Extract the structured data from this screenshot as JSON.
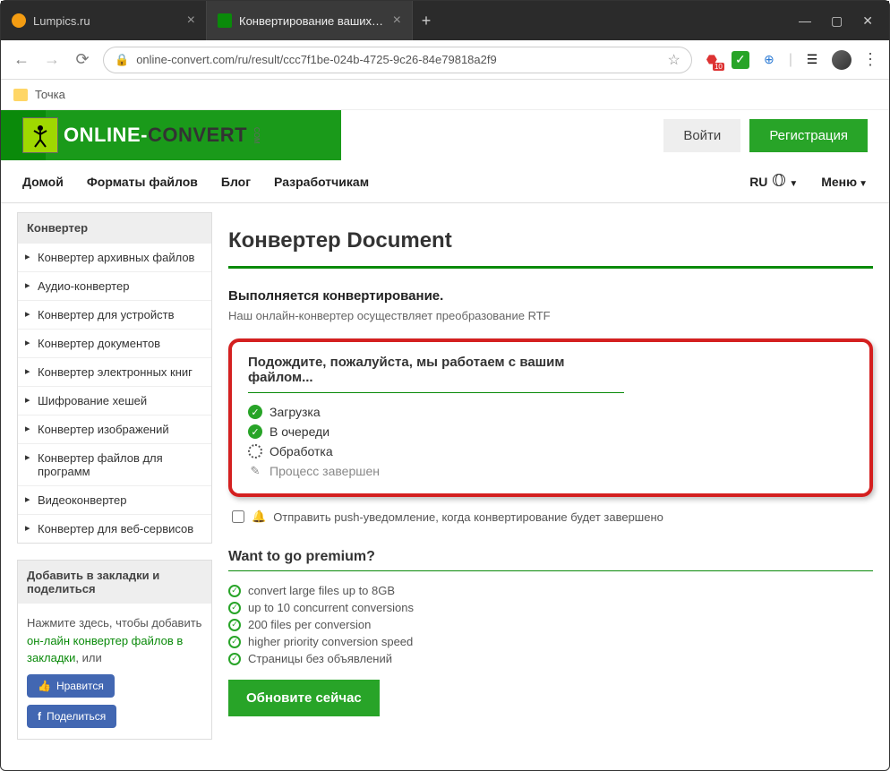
{
  "browser": {
    "tabs": [
      {
        "title": "Lumpics.ru"
      },
      {
        "title": "Конвертирование ваших файло"
      }
    ],
    "url": "online-convert.com/ru/result/ccc7f1be-024b-4725-9c26-84e79818a2f9",
    "bookmark": "Точка",
    "ext_badge": "10"
  },
  "header": {
    "logo_white": "ONLINE-",
    "logo_dark": "CONVERT",
    "logo_suffix": "COM",
    "login": "Войти",
    "register": "Регистрация"
  },
  "nav": {
    "home": "Домой",
    "formats": "Форматы файлов",
    "blog": "Блог",
    "devs": "Разработчикам",
    "lang": "RU",
    "menu": "Меню"
  },
  "sidebar": {
    "converter_title": "Конвертер",
    "items": [
      "Конвертер архивных файлов",
      "Аудио-конвертер",
      "Конвертер для устройств",
      "Конвертер документов",
      "Конвертер электронных книг",
      "Шифрование хешей",
      "Конвертер изображений",
      "Конвертер файлов для программ",
      "Видеоконвертер",
      "Конвертер для веб-сервисов"
    ],
    "bookmark_title": "Добавить в закладки и поделиться",
    "bookmark_text_pre": "Нажмите здесь, чтобы добавить ",
    "bookmark_link": "он-лайн конвертер файлов в закладки",
    "bookmark_text_post": ", или",
    "like": "Нравится",
    "share": "Поделиться"
  },
  "main": {
    "h1": "Конвертер Document",
    "progress_title": "Выполняется конвертирование.",
    "progress_sub": "Наш онлайн-конвертер осуществляет преобразование RTF",
    "wait_title": "Подождите, пожалуйста, мы работаем с вашим файлом...",
    "steps": {
      "upload": "Загрузка",
      "queue": "В очереди",
      "process": "Обработка",
      "done": "Процесс завершен"
    },
    "push_label": "Отправить push-уведомление, когда конвертирование будет завершено",
    "premium_title": "Want to go premium?",
    "premium_items": [
      "convert large files up to 8GB",
      "up to 10 concurrent conversions",
      "200 files per conversion",
      "higher priority conversion speed",
      "Страницы без объявлений"
    ],
    "upgrade": "Обновите сейчас"
  }
}
